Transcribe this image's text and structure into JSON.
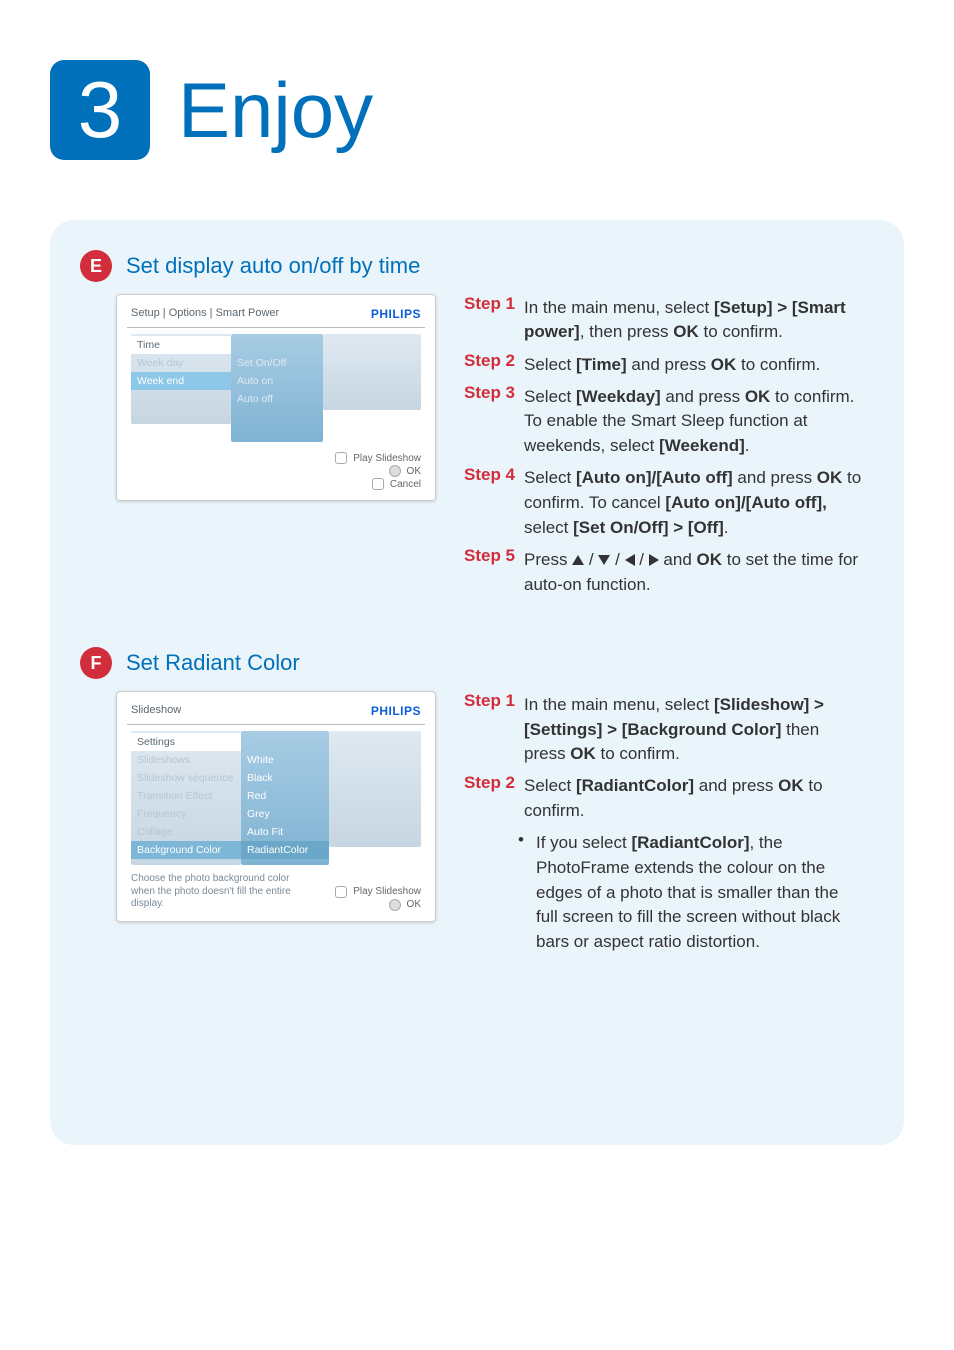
{
  "header": {
    "chapter_number": "3",
    "chapter_title": "Enjoy"
  },
  "brand": "PHILIPS",
  "sectionE": {
    "badge": "E",
    "title": "Set display auto on/off by time",
    "screenshot": {
      "breadcrumb": "Setup | Options | Smart Power",
      "left_tab": "Time",
      "left_items": [
        "Week day",
        "Week end"
      ],
      "left_selected_index": 1,
      "mid_items": [
        "Set On/Off",
        "Auto on",
        "Auto off"
      ],
      "footer": [
        "Play Slideshow",
        "OK",
        "Cancel"
      ]
    },
    "steps": [
      {
        "label": "Step 1",
        "text_html": "In the main menu, select <b>[Setup] > [Smart power]</b>, then press <b>OK</b> to confirm."
      },
      {
        "label": "Step 2",
        "text_html": "Select <b>[Time]</b> and press <b>OK</b> to confirm."
      },
      {
        "label": "Step 3",
        "text_html": "Select <b>[Weekday]</b> and press <b>OK</b> to confirm. To enable the Smart Sleep function at weekends, select <b>[Weekend]</b>."
      },
      {
        "label": "Step 4",
        "text_html": "Select <b>[Auto on]/[Auto off]</b> and press <b>OK</b> to confirm. To cancel <b>[Auto on]/[Auto off],</b> select <b>[Set On/Off] > [Off]</b>."
      },
      {
        "label": "Step 5",
        "text_html": "Press __ARROWS__ and <b>OK</b> to set the time for auto-on function."
      }
    ]
  },
  "sectionF": {
    "badge": "F",
    "title": "Set Radiant Color",
    "screenshot": {
      "breadcrumb": "Slideshow",
      "left_tab": "Settings",
      "left_items": [
        "Slideshows",
        "Slideshow sequence",
        "Transition Effect",
        "Frequency",
        "Collage",
        "Background Color"
      ],
      "left_selected_index": 5,
      "mid_items": [
        "White",
        "Black",
        "Red",
        "Grey",
        "Auto Fit",
        "RadiantColor"
      ],
      "mid_selected_index": 5,
      "hint": "Choose the photo background color when the photo doesn't fill the entire display.",
      "footer": [
        "Play Slideshow",
        "OK"
      ]
    },
    "steps": [
      {
        "label": "Step 1",
        "text_html": "In the main menu, select <b>[Slideshow] > [Settings] > [Background Color]</b> then press <b>OK</b> to confirm."
      },
      {
        "label": "Step 2",
        "text_html": "Select <b>[RadiantColor]</b> and press <b>OK</b> to confirm."
      }
    ],
    "bullet_html": "If you select <b>[RadiantColor]</b>, the PhotoFrame extends the colour on the edges of a photo that is smaller than the full screen to fill the screen without black bars or aspect ratio distortion."
  }
}
